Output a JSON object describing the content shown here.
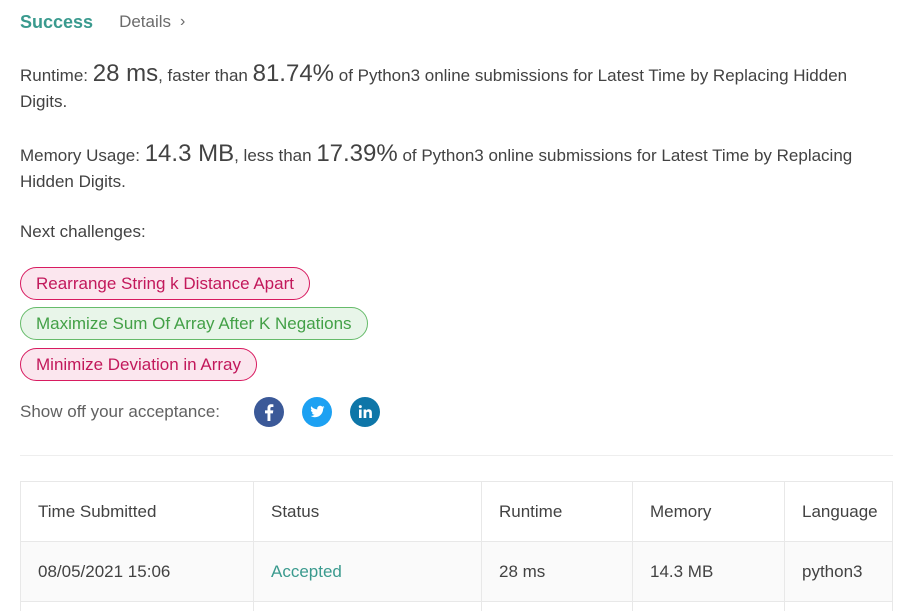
{
  "header": {
    "status": "Success",
    "details_label": "Details",
    "details_chevron": "›"
  },
  "runtime": {
    "label": "Runtime: ",
    "value": "28 ms",
    "mid": ", faster than ",
    "percent": "81.74%",
    "suffix": " of Python3 online submissions for Latest Time by Replacing Hidden Digits."
  },
  "memory": {
    "label": "Memory Usage: ",
    "value": "14.3 MB",
    "mid": ", less than ",
    "percent": "17.39%",
    "suffix": " of Python3 online submissions for Latest Time by Replacing Hidden Digits."
  },
  "next_challenges": {
    "label": "Next challenges:",
    "items": [
      {
        "title": "Rearrange String k Distance Apart",
        "difficulty": "hard"
      },
      {
        "title": "Maximize Sum Of Array After K Negations",
        "difficulty": "easy"
      },
      {
        "title": "Minimize Deviation in Array",
        "difficulty": "hard"
      }
    ]
  },
  "share": {
    "label": "Show off your acceptance:",
    "icons": [
      "facebook-icon",
      "twitter-icon",
      "linkedin-icon"
    ]
  },
  "colors": {
    "accent": "#3a9a8e",
    "hard": "#c2185b",
    "easy": "#43a047",
    "facebook": "#3b5998",
    "twitter": "#1da1f2",
    "linkedin": "#0e76a8"
  },
  "table": {
    "headers": [
      "Time Submitted",
      "Status",
      "Runtime",
      "Memory",
      "Language"
    ],
    "rows": [
      [
        "08/05/2021 15:06",
        "Accepted",
        "28 ms",
        "14.3 MB",
        "python3"
      ]
    ]
  }
}
